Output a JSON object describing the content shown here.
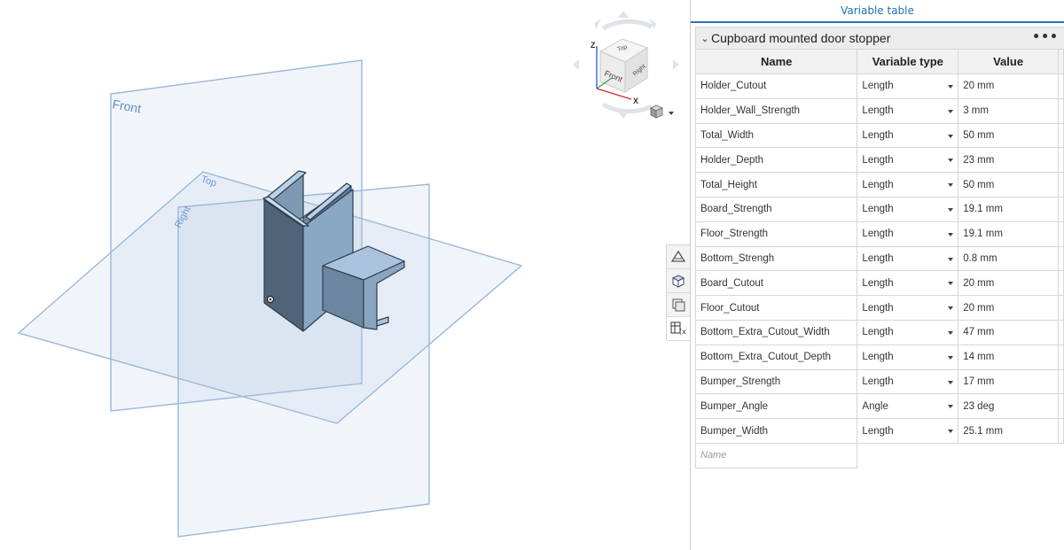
{
  "viewport": {
    "planes": {
      "front": "Front",
      "top": "Top",
      "right": "Right"
    },
    "view_cube": {
      "top": "Top",
      "front": "Front",
      "right": "Right",
      "axis_z": "Z",
      "axis_x": "X"
    }
  },
  "side_toolbar": {
    "icons": [
      "sketch-plane-icon",
      "view-cube-icon",
      "render-mode-icon",
      "variable-table-icon"
    ]
  },
  "panel": {
    "title": "Variable table",
    "table_name": "Cupboard mounted door stopper",
    "more_label": "•••",
    "columns": {
      "name": "Name",
      "type": "Variable type",
      "value": "Value"
    },
    "rows": [
      {
        "name": "Holder_Cutout",
        "type": "Length",
        "value": "20 mm"
      },
      {
        "name": "Holder_Wall_Strength",
        "type": "Length",
        "value": "3 mm"
      },
      {
        "name": "Total_Width",
        "type": "Length",
        "value": "50 mm"
      },
      {
        "name": "Holder_Depth",
        "type": "Length",
        "value": "23 mm"
      },
      {
        "name": "Total_Height",
        "type": "Length",
        "value": "50 mm"
      },
      {
        "name": "Board_Strength",
        "type": "Length",
        "value": "19.1 mm"
      },
      {
        "name": "Floor_Strength",
        "type": "Length",
        "value": "19.1 mm"
      },
      {
        "name": "Bottom_Strengh",
        "type": "Length",
        "value": "0.8 mm"
      },
      {
        "name": "Board_Cutout",
        "type": "Length",
        "value": "20 mm"
      },
      {
        "name": "Floor_Cutout",
        "type": "Length",
        "value": "20 mm"
      },
      {
        "name": "Bottom_Extra_Cutout_Width",
        "type": "Length",
        "value": "47 mm"
      },
      {
        "name": "Bottom_Extra_Cutout_Depth",
        "type": "Length",
        "value": "14 mm"
      },
      {
        "name": "Bumper_Strength",
        "type": "Length",
        "value": "17 mm"
      },
      {
        "name": "Bumper_Angle",
        "type": "Angle",
        "value": "23 deg"
      },
      {
        "name": "Bumper_Width",
        "type": "Length",
        "value": "25.1 mm"
      }
    ],
    "new_row_placeholder": "Name"
  }
}
